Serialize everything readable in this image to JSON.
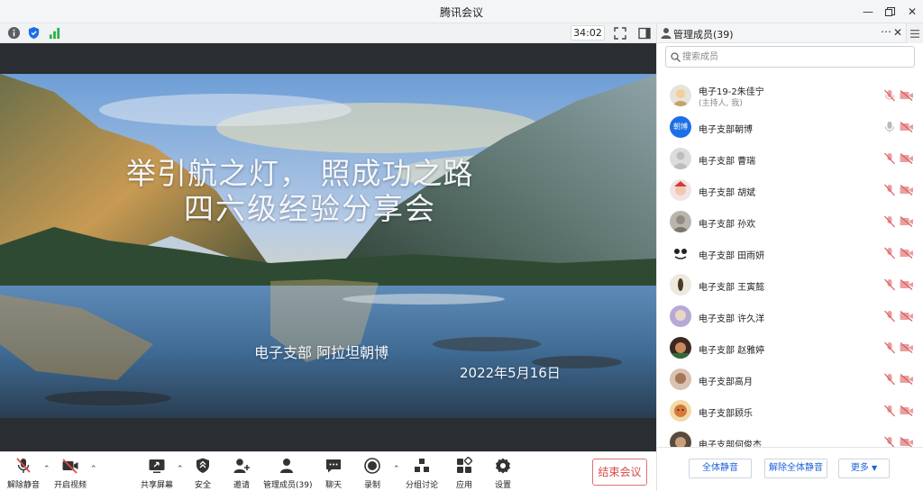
{
  "window": {
    "title": "腾讯会议",
    "minimize_icon": "minimize-icon",
    "restore_icon": "restore-icon",
    "close_icon": "close-icon"
  },
  "infobar": {
    "timer": "34:02",
    "signal_color": "#2bb24c",
    "shield_color": "#1a6fe8"
  },
  "slide": {
    "title_line1": "举引航之灯， 照成功之路",
    "title_line2": "四六级经验分享会",
    "presenter": "电子支部 阿拉坦朝博",
    "date": "2022年5月16日"
  },
  "toolbar": {
    "unmute": "解除静音",
    "start_video": "开启视频",
    "share_screen": "共享屏幕",
    "security": "安全",
    "invite": "邀请",
    "manage_members": "管理成员(39)",
    "chat": "聊天",
    "record": "录制",
    "breakout": "分组讨论",
    "apps": "应用",
    "settings": "设置",
    "end_meeting": "结束会议",
    "end_color": "#d84848"
  },
  "panel": {
    "title": "管理成员(39)",
    "search_placeholder": "搜索成员",
    "members": [
      {
        "name": "电子19-2朱佳宁",
        "role": "(主持人, 我)"
      },
      {
        "name": "电子支部朝博",
        "avatar_text": "朝博"
      },
      {
        "name": "电子支部 曹瑞"
      },
      {
        "name": "电子支部 胡斌"
      },
      {
        "name": "电子支部 孙欢"
      },
      {
        "name": "电子支部 田雨妍"
      },
      {
        "name": "电子支部 王寅懿"
      },
      {
        "name": "电子支部 许久洋"
      },
      {
        "name": "电子支部 赵雅婷"
      },
      {
        "name": "电子支部高月"
      },
      {
        "name": "电子支部顾乐"
      },
      {
        "name": "电子支部何俊杰"
      }
    ],
    "mute_all": "全体静音",
    "unmute_all": "解除全体静音",
    "more": "更多",
    "accent": "#1a62d8",
    "muted_color": "#e05a5a"
  }
}
